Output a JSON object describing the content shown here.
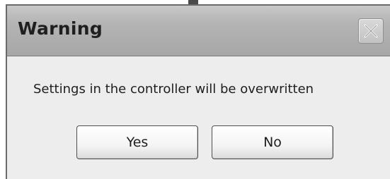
{
  "dialog": {
    "title": "Warning",
    "close_icon": "close-x-icon",
    "message": "Settings in the controller will be overwritten",
    "buttons": {
      "yes_label": "Yes",
      "no_label": "No"
    }
  }
}
